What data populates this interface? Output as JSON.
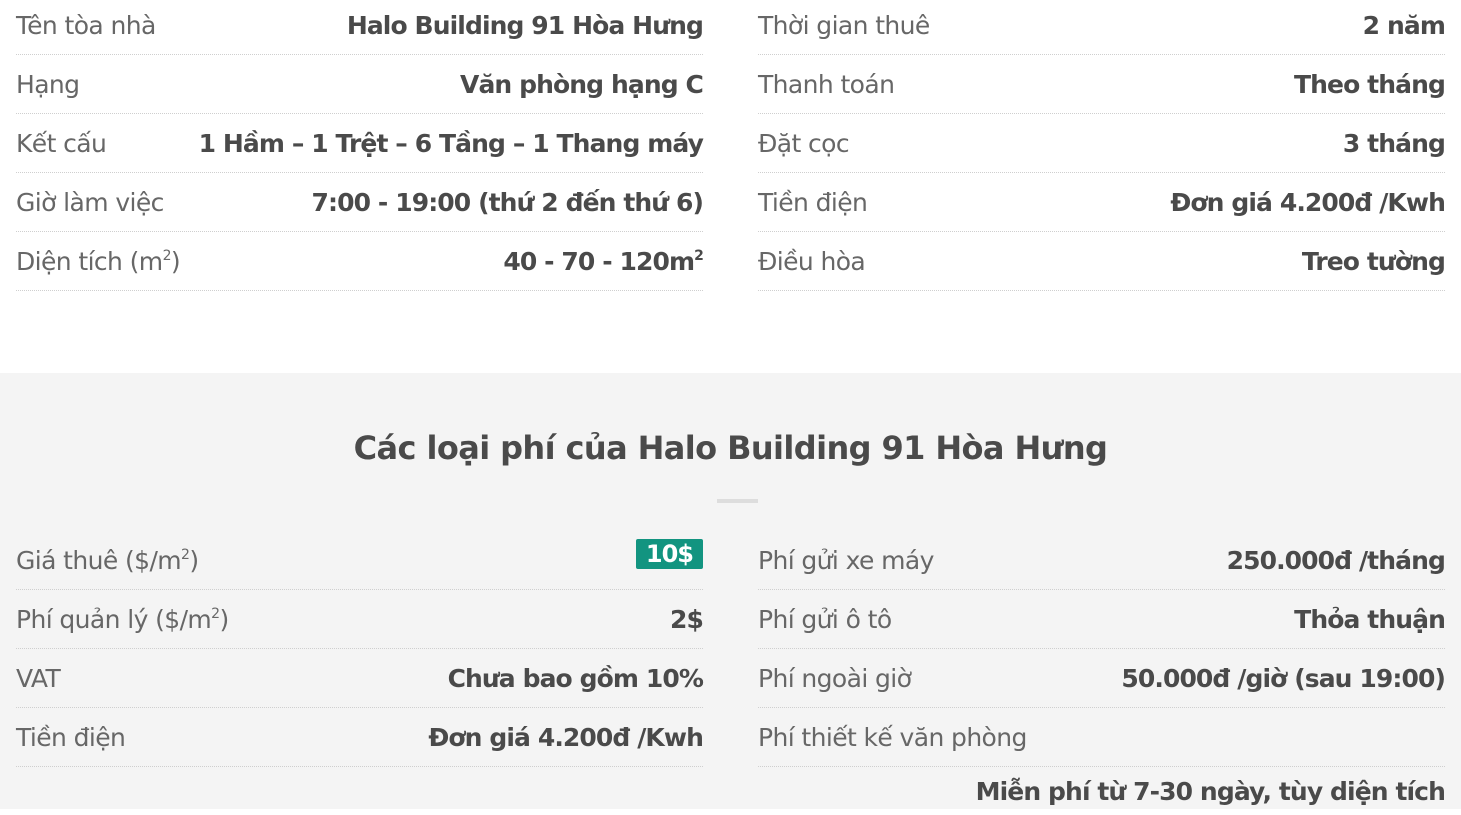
{
  "building_info": {
    "left": [
      {
        "label": "Tên tòa nhà",
        "value": "Halo Building 91 Hòa Hưng"
      },
      {
        "label": "Hạng",
        "value": "Văn phòng hạng C"
      },
      {
        "label": "Kết cấu",
        "value": "1 Hầm – 1 Trệt – 6 Tầng – 1 Thang máy"
      },
      {
        "label": "Giờ làm việc",
        "value": "7:00 - 19:00 (thứ 2 đến thứ 6)"
      },
      {
        "label": "Diện tích (m",
        "label_sup": "2",
        "label_suffix": ")",
        "value": "40 - 70 - 120m",
        "value_sup": "2"
      }
    ],
    "right": [
      {
        "label": "Thời gian thuê",
        "value": "2 năm"
      },
      {
        "label": "Thanh toán",
        "value": "Theo tháng"
      },
      {
        "label": "Đặt cọc",
        "value": "3 tháng"
      },
      {
        "label": "Tiền điện",
        "value": "Đơn giá 4.200đ /Kwh"
      },
      {
        "label": "Điều hòa",
        "value": "Treo tường"
      }
    ]
  },
  "fees": {
    "title": "Các loại phí của Halo Building 91 Hòa Hưng",
    "accent_color": "#129480",
    "left": [
      {
        "label": "Giá thuê ($/m",
        "label_sup": "2",
        "label_suffix": ")",
        "value": "10$",
        "highlight": true
      },
      {
        "label": "Phí quản lý ($/m",
        "label_sup": "2",
        "label_suffix": ")",
        "value": "2$"
      },
      {
        "label": "VAT",
        "value": "Chưa bao gồm 10%"
      },
      {
        "label": "Tiền điện",
        "value": "Đơn giá 4.200đ /Kwh"
      }
    ],
    "right": [
      {
        "label": "Phí gửi xe máy",
        "value": "250.000đ /tháng"
      },
      {
        "label": "Phí gửi ô tô",
        "value": "Thỏa thuận"
      },
      {
        "label": "Phí ngoài giờ",
        "value": "50.000đ /giờ (sau 19:00)"
      },
      {
        "label": "Phí thiết kế văn phòng",
        "value": ""
      }
    ],
    "right_overflow_value": "Miễn phí từ 7-30 ngày, tùy diện tích"
  }
}
